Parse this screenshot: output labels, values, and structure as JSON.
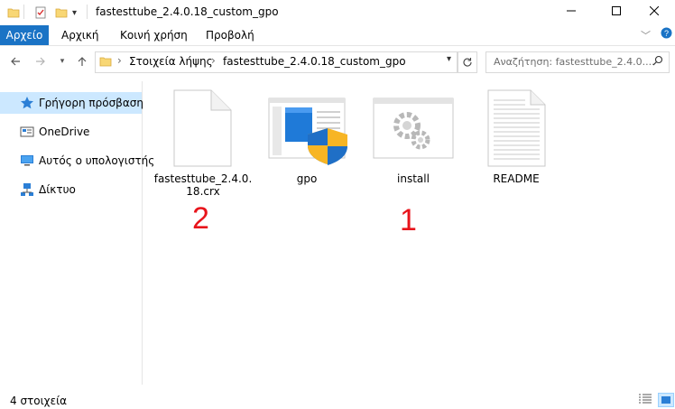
{
  "window": {
    "title": "fastesttube_2.4.0.18_custom_gpo",
    "buttons": [
      "minimize-icon",
      "maximize-icon",
      "close-icon"
    ]
  },
  "ribbon": {
    "file_tab": "Αρχείο",
    "tabs": [
      "Αρχική",
      "Κοινή χρήση",
      "Προβολή"
    ]
  },
  "address": {
    "path": [
      "Στοιχεία λήψης",
      "fastesttube_2.4.0.18_custom_gpo"
    ]
  },
  "search": {
    "placeholder": "Αναζήτηση: fastesttube_2.4.0...."
  },
  "sidebar": {
    "items": [
      {
        "label": "Γρήγορη πρόσβαση",
        "icon": "star-icon",
        "selected": true
      },
      {
        "label": "OneDrive",
        "icon": "onedrive-icon",
        "selected": false
      },
      {
        "label": "Αυτός ο υπολογιστής",
        "icon": "computer-icon",
        "selected": false
      },
      {
        "label": "Δίκτυο",
        "icon": "network-icon",
        "selected": false
      }
    ]
  },
  "files": [
    {
      "name": "fastesttube_2.4.0.\n18.crx",
      "icon": "blank-file-icon"
    },
    {
      "name": "gpo",
      "icon": "gpo-policy-icon"
    },
    {
      "name": "install",
      "icon": "install-settings-icon"
    },
    {
      "name": "README",
      "icon": "text-file-icon"
    }
  ],
  "annotations": [
    "2",
    "1"
  ],
  "status": {
    "count": "4 στοιχεία"
  },
  "colors": {
    "accent": "#1a73c5",
    "selection": "#cce8ff",
    "annotation": "#e8141b"
  }
}
